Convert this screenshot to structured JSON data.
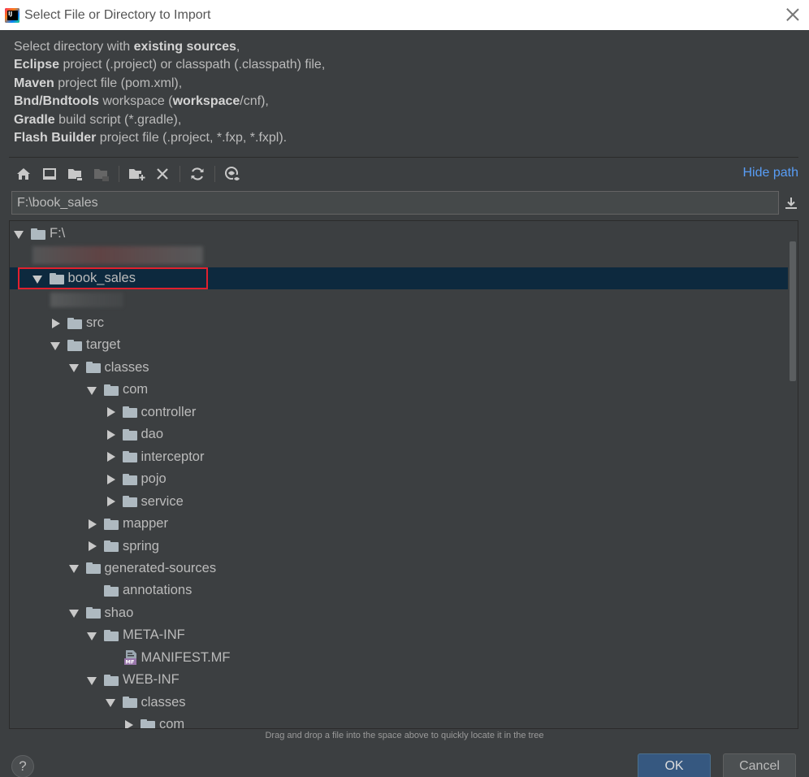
{
  "window": {
    "title": "Select File or Directory to Import"
  },
  "description": {
    "lines": [
      [
        {
          "t": "Select directory with ",
          "b": false
        },
        {
          "t": "existing sources",
          "b": true
        },
        {
          "t": ",",
          "b": false
        }
      ],
      [
        {
          "t": "Eclipse",
          "b": true
        },
        {
          "t": " project (.project) or classpath (.classpath) file,",
          "b": false
        }
      ],
      [
        {
          "t": "Maven",
          "b": true
        },
        {
          "t": " project file (pom.xml),",
          "b": false
        }
      ],
      [
        {
          "t": "Bnd/Bndtools",
          "b": true
        },
        {
          "t": " workspace (",
          "b": false
        },
        {
          "t": "workspace",
          "b": true
        },
        {
          "t": "/cnf),",
          "b": false
        }
      ],
      [
        {
          "t": "Gradle",
          "b": true
        },
        {
          "t": " build script (*.gradle),",
          "b": false
        }
      ],
      [
        {
          "t": "Flash Builder",
          "b": true
        },
        {
          "t": " project file (.project, *.fxp, *.fxpl).",
          "b": false
        }
      ]
    ]
  },
  "toolbar": {
    "icons": [
      "home-icon",
      "desktop-icon",
      "project-folder-icon",
      "module-folder-icon",
      "new-folder-icon",
      "delete-icon",
      "refresh-icon",
      "show-hidden-icon"
    ],
    "hide_path_label": "Hide path"
  },
  "path": {
    "value": "F:\\book_sales"
  },
  "tree": {
    "rows": [
      {
        "label": "F:\\",
        "depth": 0,
        "arrow": "down",
        "icon": "drive"
      },
      {
        "label": "",
        "depth": 1,
        "arrow": "none",
        "icon": "blurred"
      },
      {
        "label": "book_sales",
        "depth": 1,
        "arrow": "down",
        "icon": "folder",
        "selected": true
      },
      {
        "label": "",
        "depth": 2,
        "arrow": "none",
        "icon": "blurred"
      },
      {
        "label": "src",
        "depth": 2,
        "arrow": "right",
        "icon": "folder"
      },
      {
        "label": "target",
        "depth": 2,
        "arrow": "down",
        "icon": "folder"
      },
      {
        "label": "classes",
        "depth": 3,
        "arrow": "down",
        "icon": "folder"
      },
      {
        "label": "com",
        "depth": 4,
        "arrow": "down",
        "icon": "folder"
      },
      {
        "label": "controller",
        "depth": 5,
        "arrow": "right",
        "icon": "folder"
      },
      {
        "label": "dao",
        "depth": 5,
        "arrow": "right",
        "icon": "folder"
      },
      {
        "label": "interceptor",
        "depth": 5,
        "arrow": "right",
        "icon": "folder"
      },
      {
        "label": "pojo",
        "depth": 5,
        "arrow": "right",
        "icon": "folder"
      },
      {
        "label": "service",
        "depth": 5,
        "arrow": "right",
        "icon": "folder"
      },
      {
        "label": "mapper",
        "depth": 4,
        "arrow": "right",
        "icon": "folder"
      },
      {
        "label": "spring",
        "depth": 4,
        "arrow": "right",
        "icon": "folder"
      },
      {
        "label": "generated-sources",
        "depth": 3,
        "arrow": "down",
        "icon": "folder"
      },
      {
        "label": "annotations",
        "depth": 4,
        "arrow": "none",
        "icon": "folder"
      },
      {
        "label": "shao",
        "depth": 3,
        "arrow": "down",
        "icon": "folder"
      },
      {
        "label": "META-INF",
        "depth": 4,
        "arrow": "down",
        "icon": "folder"
      },
      {
        "label": "MANIFEST.MF",
        "depth": 5,
        "arrow": "none",
        "icon": "manifest"
      },
      {
        "label": "WEB-INF",
        "depth": 4,
        "arrow": "down",
        "icon": "folder"
      },
      {
        "label": "classes",
        "depth": 5,
        "arrow": "down",
        "icon": "folder"
      },
      {
        "label": "com",
        "depth": 6,
        "arrow": "right",
        "icon": "folder"
      }
    ]
  },
  "hint": "Drag and drop a file into the space above to quickly locate it in the tree",
  "buttons": {
    "help": "?",
    "ok": "OK",
    "cancel": "Cancel"
  },
  "colors": {
    "background": "#3c3f41",
    "selection": "#0d293e",
    "link": "#589df6",
    "ok_button": "#365880",
    "highlight_box": "#e0202e"
  }
}
